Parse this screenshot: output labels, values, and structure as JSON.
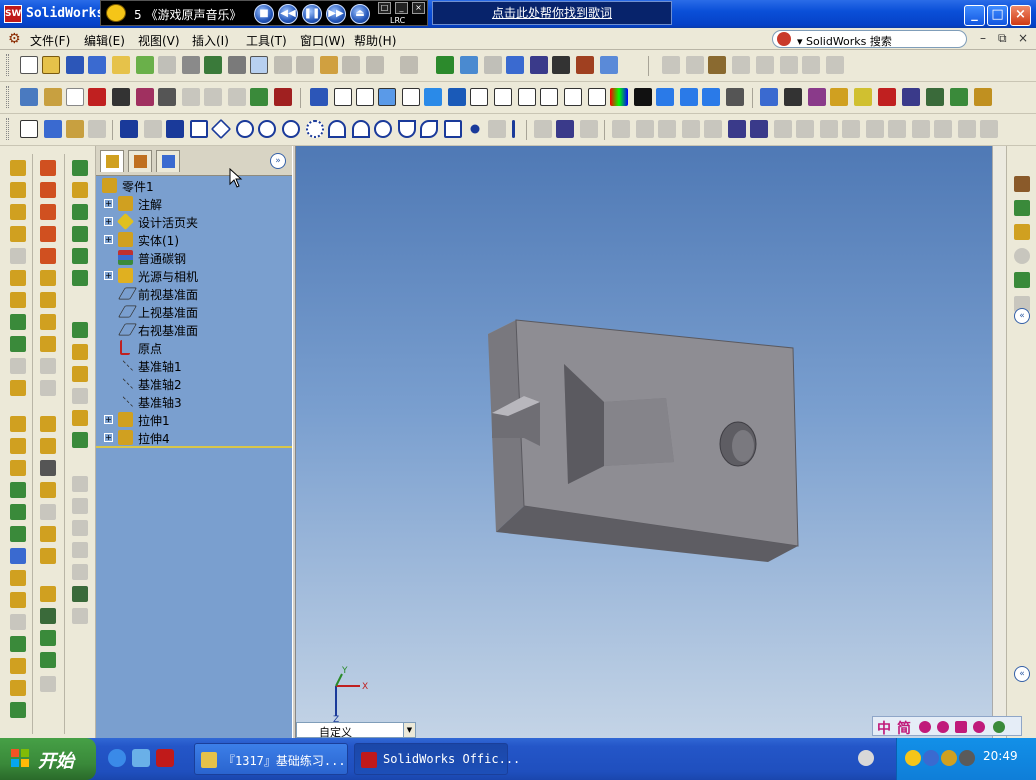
{
  "window": {
    "title": "SolidWorks",
    "logo_text": "SW",
    "colors": {
      "titlebar": "#0541c7",
      "viewport_top": "#4f79b5",
      "viewport_bottom": "#c4d4e6",
      "panel": "#7a9fcf",
      "model_face": "#8e8d93"
    }
  },
  "media_player": {
    "song": "5 《游戏原声音乐》",
    "lyric_link": "点击此处帮你找到歌词",
    "lrc_label": "LRC"
  },
  "menu": {
    "items": [
      "文件(F)",
      "编辑(E)",
      "视图(V)",
      "插入(I)",
      "工具(T)",
      "窗口(W)",
      "帮助(H)"
    ],
    "search_label": "▾ SolidWorks 搜索"
  },
  "feature_tree": {
    "root": "零件1",
    "items": [
      {
        "label": "注解",
        "expandable": true,
        "icon": "annotation-icon"
      },
      {
        "label": "设计活页夹",
        "expandable": true,
        "icon": "binder-icon"
      },
      {
        "label": "实体(1)",
        "expandable": true,
        "icon": "solid-body-icon"
      },
      {
        "label": "普通碳钢",
        "expandable": false,
        "icon": "material-icon"
      },
      {
        "label": "光源与相机",
        "expandable": true,
        "icon": "lights-cameras-icon"
      },
      {
        "label": "前视基准面",
        "expandable": false,
        "icon": "plane-icon"
      },
      {
        "label": "上视基准面",
        "expandable": false,
        "icon": "plane-icon"
      },
      {
        "label": "右视基准面",
        "expandable": false,
        "icon": "plane-icon"
      },
      {
        "label": "原点",
        "expandable": false,
        "icon": "origin-icon"
      },
      {
        "label": "基准轴1",
        "expandable": false,
        "icon": "axis-icon"
      },
      {
        "label": "基准轴2",
        "expandable": false,
        "icon": "axis-icon"
      },
      {
        "label": "基准轴3",
        "expandable": false,
        "icon": "axis-icon"
      },
      {
        "label": "拉伸1",
        "expandable": true,
        "icon": "extrude-icon"
      },
      {
        "label": "拉伸4",
        "expandable": true,
        "icon": "extrude-icon"
      }
    ]
  },
  "view": {
    "orientation_label": "自定义",
    "triad": {
      "x": "X",
      "y": "Y",
      "z": "Z"
    }
  },
  "ime": {
    "chars": [
      "中",
      "简"
    ]
  },
  "taskbar": {
    "start": "开始",
    "tasks": [
      {
        "label": "『1317』基础练习...",
        "active": false
      },
      {
        "label": "SolidWorks Offic...",
        "active": true
      }
    ],
    "clock": "20:49"
  }
}
